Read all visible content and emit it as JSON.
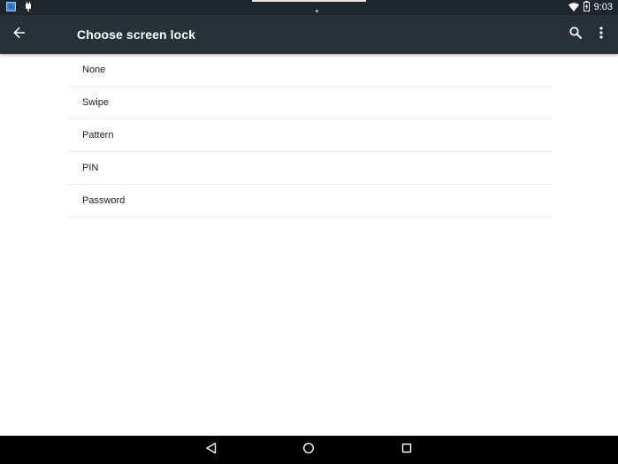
{
  "status_bar": {
    "time": "9:03",
    "left_icons": [
      "app-notification-icon",
      "android-debug-icon"
    ],
    "right_icons": [
      "wifi-icon",
      "battery-charging-icon"
    ]
  },
  "app_bar": {
    "title": "Choose screen lock",
    "back_icon": "arrow-back-icon",
    "search_icon": "search-icon",
    "more_icon": "more-vert-icon"
  },
  "options": [
    {
      "label": "None"
    },
    {
      "label": "Swipe"
    },
    {
      "label": "Pattern"
    },
    {
      "label": "PIN"
    },
    {
      "label": "Password"
    }
  ],
  "nav_bar": {
    "icons": [
      "nav-back-icon",
      "nav-home-icon",
      "nav-recents-icon"
    ]
  },
  "colors": {
    "status_bar": "#1f272c",
    "app_bar": "#263238",
    "background": "#ffffff",
    "divider": "#ececec",
    "nav_bar": "#000000",
    "text_primary": "#212121"
  }
}
